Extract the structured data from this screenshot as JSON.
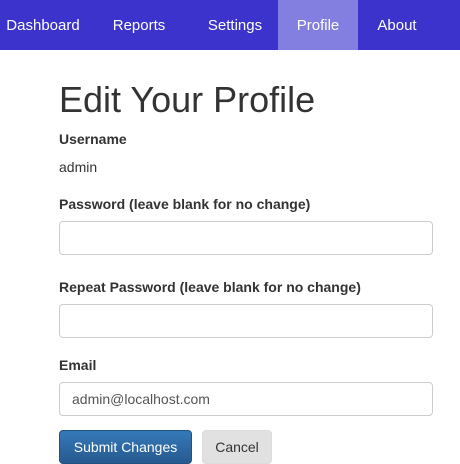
{
  "nav": {
    "items": [
      {
        "label": "Dashboard"
      },
      {
        "label": "Reports"
      },
      {
        "label": "Settings"
      },
      {
        "label": "Profile"
      },
      {
        "label": "About"
      }
    ],
    "active": "Profile",
    "bg_color": "#3b33cc",
    "active_color": "#837fe0"
  },
  "page": {
    "title": "Edit Your Profile"
  },
  "form": {
    "username": {
      "label": "Username",
      "value": "admin"
    },
    "password": {
      "label": "Password (leave blank for no change)",
      "value": ""
    },
    "repeat_password": {
      "label": "Repeat Password (leave blank for no change)",
      "value": ""
    },
    "email": {
      "label": "Email",
      "value": "admin@localhost.com"
    },
    "submit_label": "Submit Changes",
    "cancel_label": "Cancel"
  }
}
